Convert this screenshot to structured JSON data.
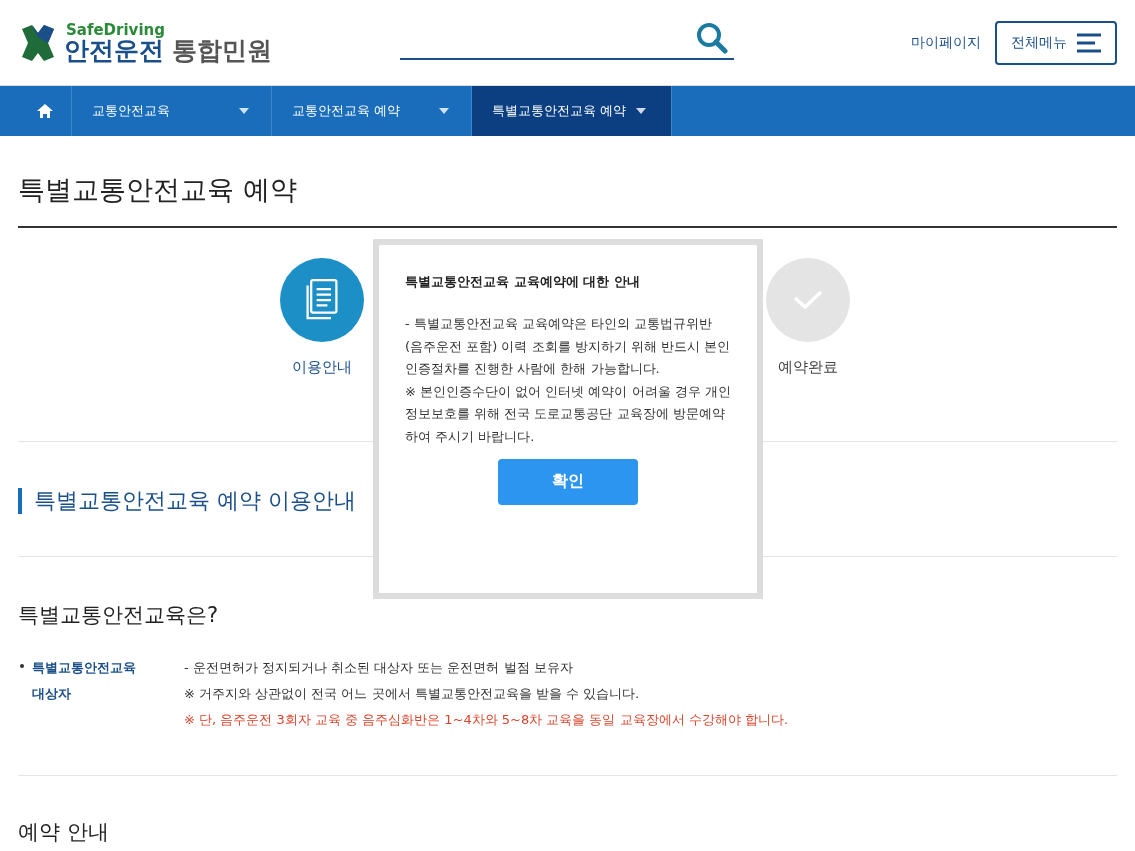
{
  "header": {
    "logo_small": "SafeDriving",
    "logo_main": "안전운전",
    "logo_sub": "통합민원",
    "links": [
      "마이페이지"
    ],
    "menu_button": "전체메뉴"
  },
  "nav": {
    "items": [
      {
        "label": "교통안전교육",
        "selected": false
      },
      {
        "label": "교통안전교육 예약",
        "selected": false
      },
      {
        "label": "특별교통안전교육 예약",
        "selected": true
      }
    ]
  },
  "page_title": "특별교통안전교육 예약",
  "steps": [
    {
      "label": "이용안내",
      "kind": "document",
      "selected": true
    },
    {
      "label": "예약완료",
      "kind": "check",
      "selected": false
    }
  ],
  "section_title": "특별교통안전교육 예약 이용안내",
  "intro": {
    "heading": "특별교통안전교육은?",
    "term": [
      "특별교통안전교육",
      "대상자"
    ],
    "lines": [
      {
        "text": "- 운전면허가 정지되거나 취소된 대상자 또는 운전면허 벌점 보유자",
        "kind": "normal"
      },
      {
        "text": "※ 거주지와 상관없이 전국 어느 곳에서 특별교통안전교육을 받을 수 있습니다.",
        "kind": "normal"
      },
      {
        "text": "※ 단, 음주운전 3회자 교육 중 음주심화반은 1~4차와 5~8차 교육을 동일 교육장에서 수강해야 합니다.",
        "kind": "warning"
      }
    ]
  },
  "next_heading": "예약 안내",
  "modal": {
    "title": "특별교통안전교육 교육예약에 대한 안내",
    "body": [
      "- 특별교통안전교육 교육예약은 타인의 교통법규위반 (음주운전 포함) 이력 조회를 방지하기 위해 반드시 본인인증절차를 진행한 사람에 한해 가능합니다.",
      "※ 본인인증수단이 없어 인터넷 예약이 어려울 경우 개인정보보호를 위해 전국 도로교통공단 교육장에 방문예약하여 주시기 바랍니다."
    ],
    "button": "확인"
  }
}
